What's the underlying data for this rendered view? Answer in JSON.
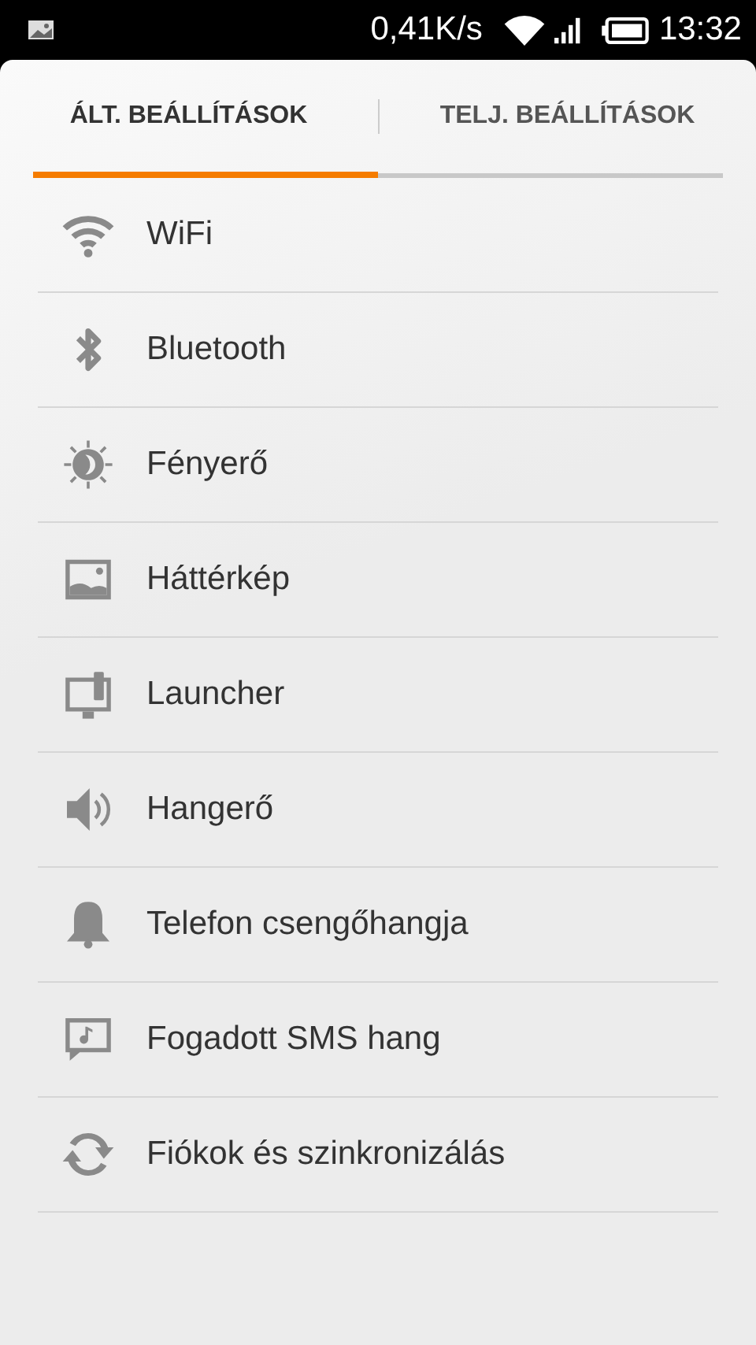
{
  "status_bar": {
    "speed": "0,41K/s",
    "time": "13:32"
  },
  "tabs": [
    {
      "label": "ÁLT. BEÁLLÍTÁSOK",
      "selected": true
    },
    {
      "label": "TELJ. BEÁLLÍTÁSOK",
      "selected": false
    }
  ],
  "items": [
    {
      "kind": "wifi",
      "label": "WiFi"
    },
    {
      "kind": "bluetooth",
      "label": "Bluetooth"
    },
    {
      "kind": "brightness",
      "label": "Fényerő"
    },
    {
      "kind": "wallpaper",
      "label": "Háttérkép"
    },
    {
      "kind": "launcher",
      "label": "Launcher"
    },
    {
      "kind": "volume",
      "label": "Hangerő"
    },
    {
      "kind": "ringtone",
      "label": "Telefon csengőhangja"
    },
    {
      "kind": "sms",
      "label": "Fogadott SMS hang"
    },
    {
      "kind": "sync",
      "label": "Fiókok és szinkronizálás"
    }
  ]
}
